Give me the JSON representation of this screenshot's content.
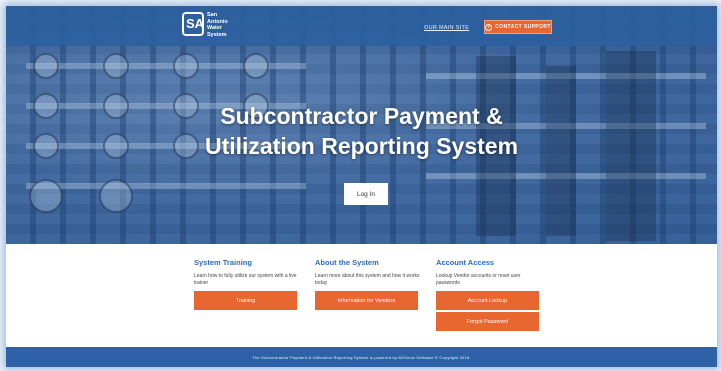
{
  "header": {
    "logo_text": "San Antonio Water System",
    "logo_mark": "SA",
    "main_site_link": "OUR MAIN SITE",
    "support_label": "CONTACT SUPPORT"
  },
  "hero": {
    "title_line1": "Subcontractor Payment &",
    "title_line2": "Utilization Reporting System",
    "login_label": "Log In"
  },
  "sections": [
    {
      "heading": "System Training",
      "text": "Learn how to fully utilize our system with a live trainer",
      "buttons": [
        "Training"
      ]
    },
    {
      "heading": "About the System",
      "text": "Learn more about this system and how it works today",
      "buttons": [
        "Information for Vendors"
      ]
    },
    {
      "heading": "Account Access",
      "text": "Lookup Vendor accounts or reset user passwords",
      "buttons": [
        "Account Lookup",
        "Forgot Password"
      ]
    }
  ],
  "footer": {
    "text": "The Subcontractor Payment & Utilization Reporting System is powered by B2Gnow Software © Copyright 2018."
  },
  "colors": {
    "accent_orange": "#e8662f",
    "brand_blue": "#2d62a8",
    "heading_blue": "#2c6db6"
  },
  "icons": [
    "logo-icon",
    "support-icon"
  ]
}
